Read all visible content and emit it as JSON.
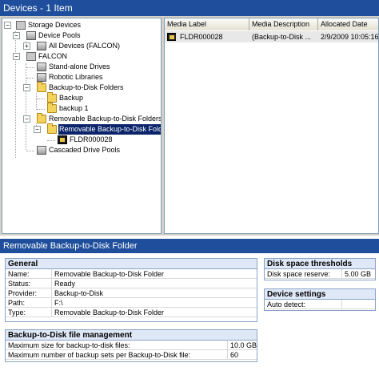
{
  "window": {
    "title": "Devices - 1 Item"
  },
  "tree": {
    "root": "Storage Devices",
    "device_pools": "Device Pools",
    "all_devices": "All Devices (FALCON)",
    "falcon": "FALCON",
    "standalone": "Stand-alone Drives",
    "robotic": "Robotic Libraries",
    "b2d_folders": "Backup-to-Disk Folders",
    "backup": "Backup",
    "backup1": "backup 1",
    "removable_folders": "Removable Backup-to-Disk Folders",
    "removable_folder": "Removable Backup-to-Disk Folder",
    "fldr": "FLDR000028",
    "cascaded": "Cascaded Drive Pools"
  },
  "list": {
    "columns": [
      "Media Label",
      "Media Description",
      "Allocated Date"
    ],
    "rows": [
      {
        "label": "FLDR000028",
        "description": "(Backup-to-Disk ...",
        "date": "2/9/2009 10:05:16"
      }
    ]
  },
  "detail": {
    "title": "Removable Backup-to-Disk Folder",
    "general": {
      "heading": "General",
      "rows": [
        {
          "key": "Name:",
          "value": "Removable Backup-to-Disk Folder"
        },
        {
          "key": "Status:",
          "value": "Ready"
        },
        {
          "key": "Provider:",
          "value": "Backup-to-Disk"
        },
        {
          "key": "Path:",
          "value": "F:\\"
        },
        {
          "key": "Type:",
          "value": "Removable Backup-to-Disk Folder"
        }
      ]
    },
    "thresholds": {
      "heading": "Disk space thresholds",
      "rows": [
        {
          "key": "Disk space reserve:",
          "value": "5.00 GB"
        }
      ]
    },
    "settings": {
      "heading": "Device settings",
      "rows": [
        {
          "key": "Auto detect:",
          "value": ""
        }
      ]
    },
    "file_mgmt": {
      "heading": "Backup-to-Disk file management",
      "rows": [
        {
          "key": "Maximum size for backup-to-disk files:",
          "value": "10.0 GB"
        },
        {
          "key": "Maximum number of backup sets per Backup-to-Disk file:",
          "value": "60"
        }
      ]
    }
  }
}
